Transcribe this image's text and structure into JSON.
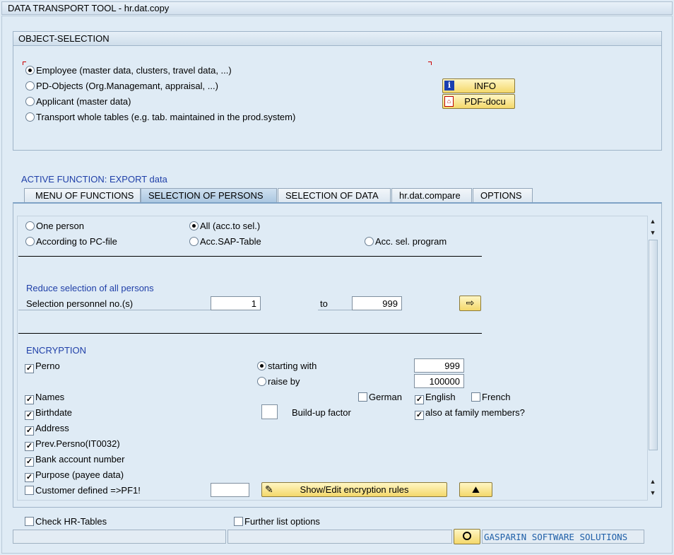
{
  "window": {
    "title": "DATA TRANSPORT TOOL - hr.dat.copy"
  },
  "object_selection": {
    "header": "OBJECT-SELECTION",
    "options": [
      {
        "label": "Employee (master data, clusters, travel data, ...)",
        "selected": true
      },
      {
        "label": "PD-Objects (Org.Managemant, appraisal, ...)",
        "selected": false
      },
      {
        "label": "Applicant (master data)",
        "selected": false
      },
      {
        "label": "Transport whole tables (e.g. tab. maintained in the prod.system)",
        "selected": false
      }
    ],
    "info_button": "INFO",
    "pdf_button": "PDF-docu"
  },
  "active_function": "ACTIVE FUNCTION: EXPORT data",
  "tabs": [
    {
      "label": "MENU OF FUNCTIONS",
      "active": false
    },
    {
      "label": "SELECTION OF PERSONS",
      "active": true
    },
    {
      "label": "SELECTION OF DATA",
      "active": false
    },
    {
      "label": "hr.dat.compare",
      "active": false
    },
    {
      "label": "OPTIONS",
      "active": false
    }
  ],
  "persons": {
    "one_person": "One person",
    "all_sel": "All (acc.to sel.)",
    "pc_file": "According to PC-file",
    "sap_table": "Acc.SAP-Table",
    "sel_program": "Acc. sel. program",
    "reduce_title": "Reduce selection of all persons",
    "sel_label": "Selection personnel no.(s)",
    "from_value": "1",
    "to_label": "to",
    "to_value": "999"
  },
  "encryption": {
    "title": "ENCRYPTION",
    "perno": "Perno",
    "starting_with": "starting with",
    "starting_value": "999",
    "raise_by": "raise by",
    "raise_value": "100000",
    "names": "Names",
    "german": "German",
    "english": "English",
    "french": "French",
    "birthdate": "Birthdate",
    "buildup": "Build-up factor",
    "family": "also at family members?",
    "address": "Address",
    "prev_perno": "Prev.Persno(IT0032)",
    "bank": "Bank account number",
    "purpose": "Purpose (payee data)",
    "customer": "Customer defined =>PF1!",
    "show_edit": "Show/Edit encryption rules"
  },
  "footer": {
    "check_hr": "Check HR-Tables",
    "further": "Further list options",
    "brand": "GASPARIN SOFTWARE SOLUTIONS"
  },
  "colors": {
    "accent_blue": "#1f3fa8",
    "button_yellow": "#f4d86b"
  }
}
